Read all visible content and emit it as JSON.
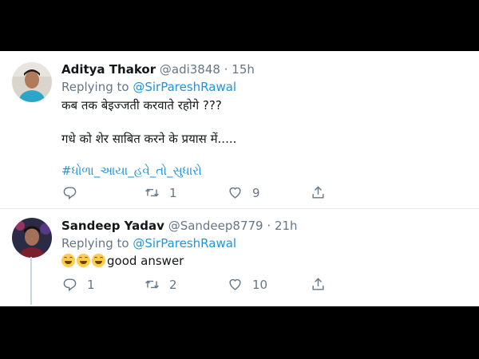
{
  "tweets": [
    {
      "name": "Aditya Thakor",
      "handle": "@adi3848",
      "dot": "·",
      "time": "15h",
      "replying_prefix": "Replying to",
      "replying_handle": "@SirPareshRawal",
      "line1": "कब तक बेइज्जती करवाते रहोगे ???",
      "line2": "गधे को शेर साबित करने के प्रयास में.....",
      "hashtag": "#ધોળા_આયા_હવે_તો_સુધારો",
      "replies": "",
      "retweets": "1",
      "likes": "9"
    },
    {
      "name": "Sandeep Yadav",
      "handle": "@Sandeep8779",
      "dot": "·",
      "time": "21h",
      "replying_prefix": "Replying to",
      "replying_handle": "@SirPareshRawal",
      "text": "good answer",
      "replies": "1",
      "retweets": "2",
      "likes": "10"
    }
  ],
  "icons": [
    "reply-icon",
    "retweet-icon",
    "like-icon",
    "share-icon"
  ],
  "colors": {
    "link": "#1b95e0",
    "muted": "#657786",
    "text": "#14171a",
    "emoji": "#ffcc4d"
  }
}
